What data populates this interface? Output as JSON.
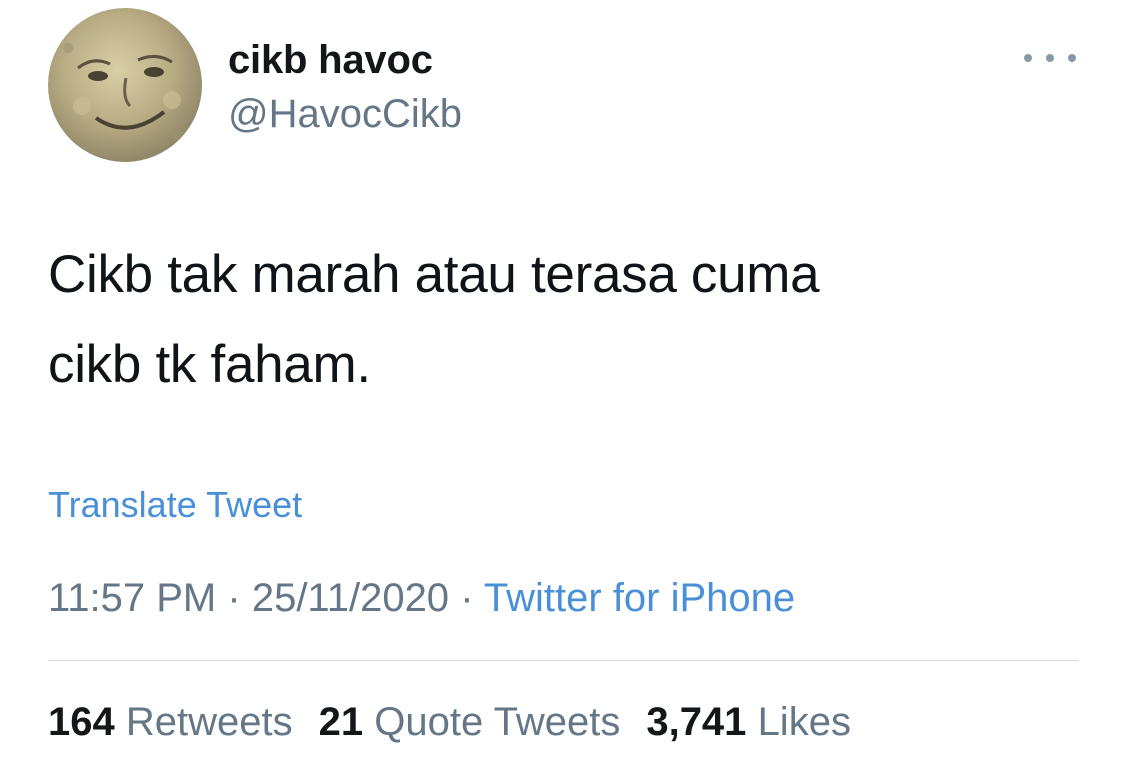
{
  "author": {
    "display_name": "cikb havoc",
    "handle": "@HavocCikb"
  },
  "tweet": {
    "text": "Cikb tak marah atau terasa cuma\ncikb tk faham.",
    "translate_label": "Translate Tweet",
    "time": "11:57 PM",
    "separator": "·",
    "date": "25/11/2020",
    "source": "Twitter for iPhone"
  },
  "stats": {
    "retweets_count": "164",
    "retweets_label": "Retweets",
    "quotes_count": "21",
    "quotes_label": "Quote Tweets",
    "likes_count": "3,741",
    "likes_label": "Likes"
  },
  "icons": {
    "more": "more-horizontal-icon"
  },
  "colors": {
    "link": "#4a90d9",
    "secondary_text": "#657786",
    "primary_text": "#14171a"
  }
}
